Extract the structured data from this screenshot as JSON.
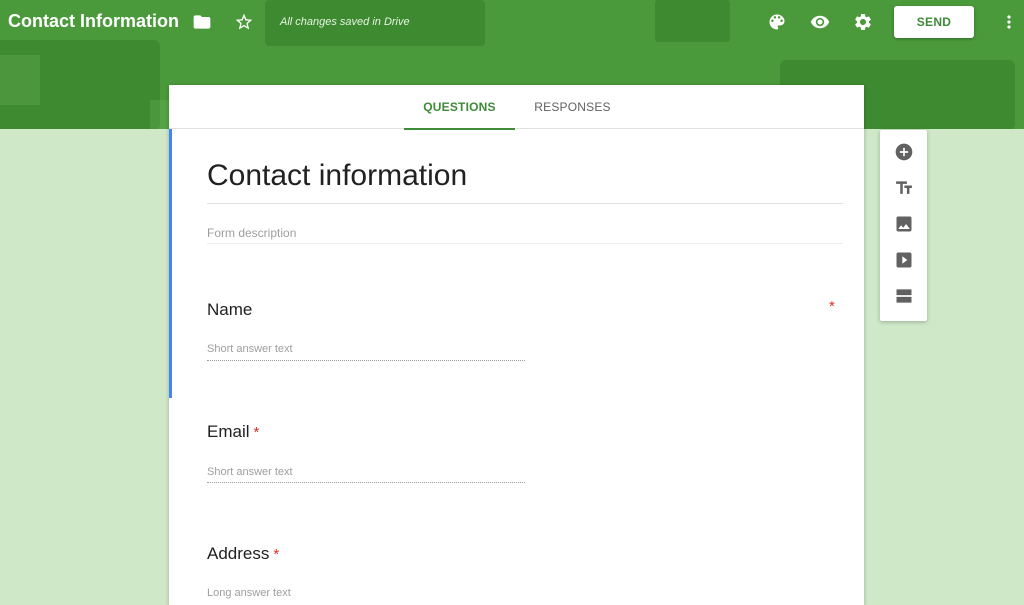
{
  "app": {
    "title": "Contact Information",
    "saved_status": "All changes saved in Drive",
    "send_label": "SEND"
  },
  "icons": {
    "folder": "folder-icon",
    "star": "star-outline-icon",
    "palette": "palette-icon",
    "preview": "eye-icon",
    "settings": "gear-icon",
    "more": "more-vert-icon"
  },
  "tabs": [
    {
      "label": "QUESTIONS",
      "active": true
    },
    {
      "label": "RESPONSES",
      "active": false
    }
  ],
  "form": {
    "title": "Contact information",
    "description_placeholder": "Form description",
    "questions": [
      {
        "label": "Name",
        "required": true,
        "hint": "Short answer text"
      },
      {
        "label": "Email",
        "required": true,
        "hint": "Short answer text"
      },
      {
        "label": "Address",
        "required": true,
        "hint": "Long answer text"
      }
    ],
    "required_mark": "*"
  },
  "side_toolbar": {
    "tools": [
      "add-question-icon",
      "title-text-icon",
      "image-icon",
      "video-icon",
      "section-icon"
    ]
  },
  "colors": {
    "header_green": "#4a9a3b",
    "accent_green": "#3d8b37",
    "background_green": "#cfe8c8",
    "focus_blue": "#4285f4",
    "required_red": "#d93025"
  }
}
